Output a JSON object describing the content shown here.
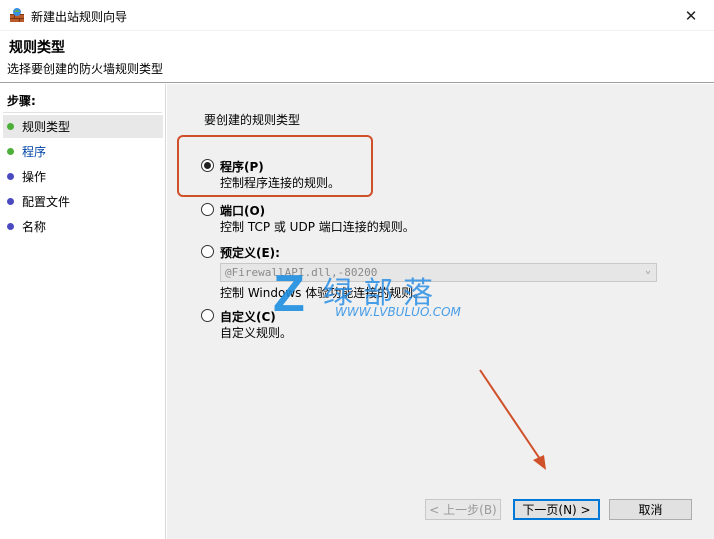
{
  "window": {
    "title": "新建出站规则向导",
    "close_glyph": "✕"
  },
  "header": {
    "title": "规则类型",
    "subtitle": "选择要创建的防火墙规则类型"
  },
  "sidebar": {
    "steps_label": "步骤:",
    "items": [
      {
        "label": "规则类型",
        "dot_color": "#4caf3a",
        "state": "active"
      },
      {
        "label": "程序",
        "dot_color": "#4caf3a",
        "state": "link"
      },
      {
        "label": "操作",
        "dot_color": "#4a4ac0",
        "state": "normal"
      },
      {
        "label": "配置文件",
        "dot_color": "#4a4ac0",
        "state": "normal"
      },
      {
        "label": "名称",
        "dot_color": "#4a4ac0",
        "state": "normal"
      }
    ]
  },
  "main": {
    "prompt": "要创建的规则类型",
    "options": [
      {
        "label": "程序(P)",
        "desc": "控制程序连接的规则。",
        "checked": true
      },
      {
        "label": "端口(O)",
        "desc": "控制 TCP 或 UDP 端口连接的规则。",
        "checked": false
      },
      {
        "label": "预定义(E):",
        "desc": "控制 Windows 体验功能连接的规则。",
        "checked": false
      },
      {
        "label": "自定义(C)",
        "desc": "自定义规则。",
        "checked": false
      }
    ],
    "predefined_select_value": "@FirewallAPI.dll,-80200",
    "highlight_color": "#d0502a"
  },
  "buttons": {
    "back": "< 上一步(B)",
    "next": "下一页(N) >",
    "cancel": "取消"
  },
  "watermark": {
    "logo_letter": "Z",
    "text": "绿部落",
    "url": "WWW.LVBULUO.COM"
  },
  "colors": {
    "accent": "#0078d7",
    "annotation": "#d0502a"
  }
}
